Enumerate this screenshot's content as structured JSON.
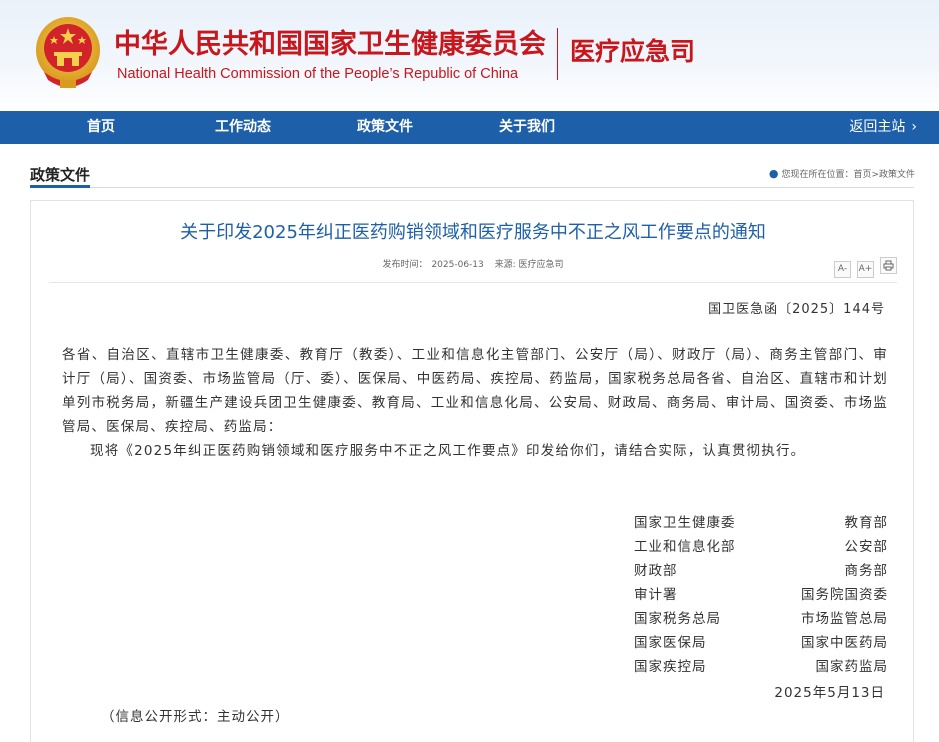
{
  "header": {
    "org_cn": "中华人民共和国国家卫生健康委员会",
    "org_en": "National Health Commission of the People’s  Republic of China",
    "dept": "医疗应急司",
    "emblem_icon": "national-emblem-icon"
  },
  "nav": {
    "items": [
      "首页",
      "工作动态",
      "政策文件",
      "关于我们"
    ],
    "active": "政策文件",
    "back_label": "返回主站"
  },
  "breadcrumb": {
    "section": "政策文件",
    "location_prefix": "您现在所在位置：",
    "path": "首页>政策文件"
  },
  "article": {
    "title": "关于印发2025年纠正医药购销领域和医疗服务中不正之风工作要点的通知",
    "published_label": "发布时间：",
    "published": "2025-06-13",
    "source_label": "来源: 医疗应急司",
    "tools": [
      "A-",
      "A+",
      "print"
    ],
    "doc_no": "国卫医急函〔2025〕144号",
    "recipients": "各省、自治区、直辖市卫生健康委、教育厅（教委）、工业和信息化主管部门、公安厅（局）、财政厅（局）、商务主管部门、审计厅（局）、国资委、市场监管局（厅、委）、医保局、中医药局、疾控局、药监局，国家税务总局各省、自治区、直辖市和计划单列市税务局，新疆生产建设兵团卫生健康委、教育局、工业和信息化局、公安局、财政局、商务局、审计局、国资委、市场监管局、医保局、疾控局、药监局：",
    "body": "现将《2025年纠正医药购销领域和医疗服务中不正之风工作要点》印发给你们，请结合实际，认真贯彻执行。",
    "signers": [
      [
        "国家卫生健康委",
        "教育部"
      ],
      [
        "工业和信息化部",
        "公安部"
      ],
      [
        "财政部",
        "商务部"
      ],
      [
        "审计署",
        "国务院国资委"
      ],
      [
        "国家税务总局",
        "市场监管总局"
      ],
      [
        "国家医保局",
        "国家中医药局"
      ],
      [
        "国家疾控局",
        "国家药监局"
      ]
    ],
    "date": "2025年5月13日",
    "disclosure": "（信息公开形式：主动公开）"
  },
  "colors": {
    "brand_red": "#c8161d",
    "nav_blue": "#1d5fa8",
    "title_blue": "#1d5fa8"
  }
}
